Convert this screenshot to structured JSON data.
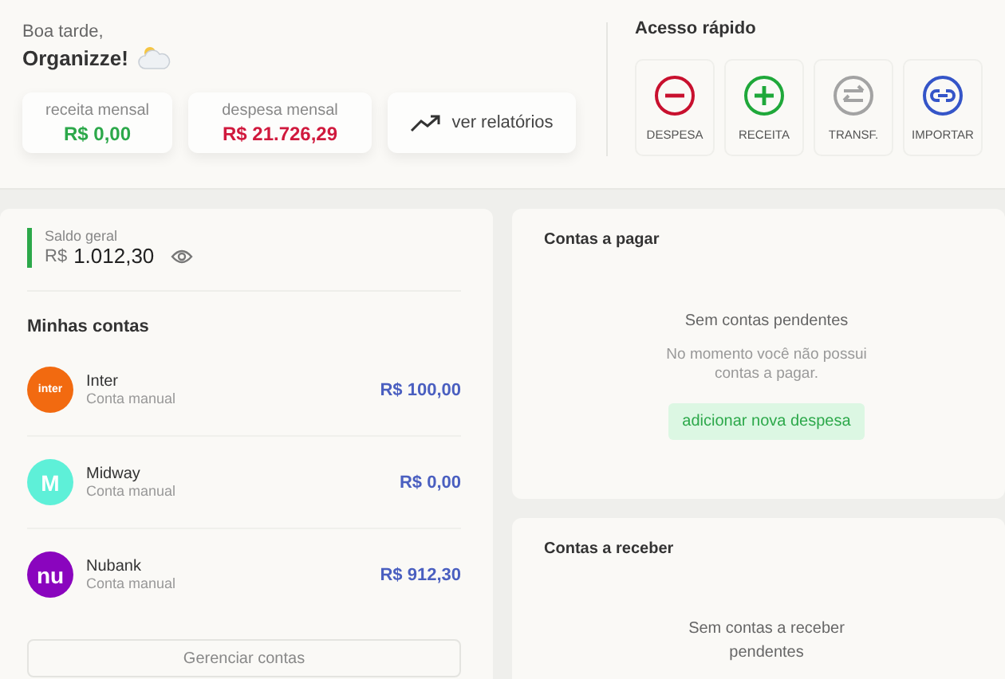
{
  "greeting": {
    "line": "Boa tarde,",
    "name": "Organizze!"
  },
  "summary": [
    {
      "label": "receita mensal",
      "value": "R$ 0,00",
      "kind": "income"
    },
    {
      "label": "despesa mensal",
      "value": "R$ 21.726,29",
      "kind": "expense"
    }
  ],
  "reports_link": "ver relatórios",
  "quick_access": {
    "title": "Acesso rápido",
    "actions": [
      {
        "label": "DESPESA",
        "kind": "minus",
        "color": "#c8102e"
      },
      {
        "label": "RECEITA",
        "kind": "plus",
        "color": "#1fa83a"
      },
      {
        "label": "TRANSF.",
        "kind": "swap",
        "color": "#a3a3a3"
      },
      {
        "label": "IMPORTAR",
        "kind": "link",
        "color": "#3555c8"
      }
    ]
  },
  "balance": {
    "label": "Saldo geral",
    "currency": "R$",
    "value": "1.012,30"
  },
  "accounts": {
    "title": "Minhas contas",
    "items": [
      {
        "logo": "inter",
        "name": "Inter",
        "type": "Conta manual",
        "value": "R$ 100,00",
        "color": "#f26a10"
      },
      {
        "logo": "M",
        "name": "Midway",
        "type": "Conta manual",
        "value": "R$ 0,00",
        "color": "#5ef0d8"
      },
      {
        "logo": "nu",
        "name": "Nubank",
        "type": "Conta manual",
        "value": "R$ 912,30",
        "color": "#8a05be"
      }
    ],
    "manage_button": "Gerenciar contas"
  },
  "payables": {
    "title": "Contas a pagar",
    "empty_title": "Sem contas pendentes",
    "empty_text": "No momento você não possui contas a pagar.",
    "action": "adicionar nova despesa"
  },
  "receivables": {
    "title": "Contas a receber",
    "empty_title": "Sem contas a receber pendentes"
  }
}
